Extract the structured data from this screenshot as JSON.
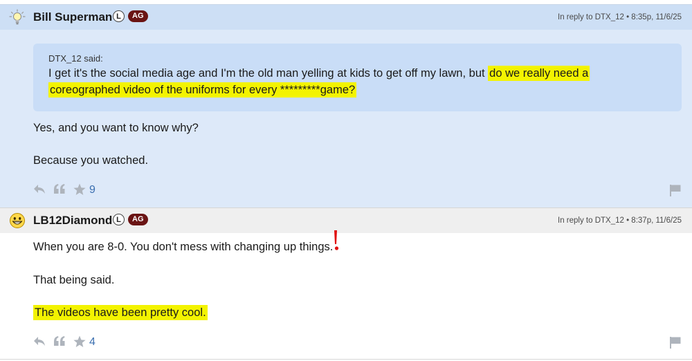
{
  "posts": [
    {
      "username": "Bill Superman",
      "badge_l": "L",
      "badge_ag": "AG",
      "reply_meta": "In reply to DTX_12 • 8:35p, 11/6/25",
      "avatar_icon": "lightbulb-icon",
      "quote": {
        "author": "DTX_12 said:",
        "text_plain": "I get it's the social media age and I'm the old man yelling at kids to get off my lawn, but ",
        "text_highlight_1": "do we really need a",
        "text_highlight_2": "coreographed video of the uniforms for every *********game?"
      },
      "body": [
        "Yes, and you want to know why?",
        "Because you watched."
      ],
      "star_count": "9"
    },
    {
      "username": "LB12Diamond",
      "badge_l": "L",
      "badge_ag": "AG",
      "reply_meta": "In reply to DTX_12 • 8:37p, 11/6/25",
      "avatar_icon": "grinning-face-icon",
      "body": [
        "When you are 8-0. You don't mess with changing up things.",
        "That being said.",
        "The videos have been pretty cool."
      ],
      "star_count": "4"
    }
  ],
  "colors": {
    "highlight": "#f3f300",
    "post1_bg": "#dde9f9",
    "quote_bg": "#c9ddf7",
    "badge_ag": "#6a1414",
    "count": "#3b6fb0",
    "annotation_mark": "#e01010"
  }
}
